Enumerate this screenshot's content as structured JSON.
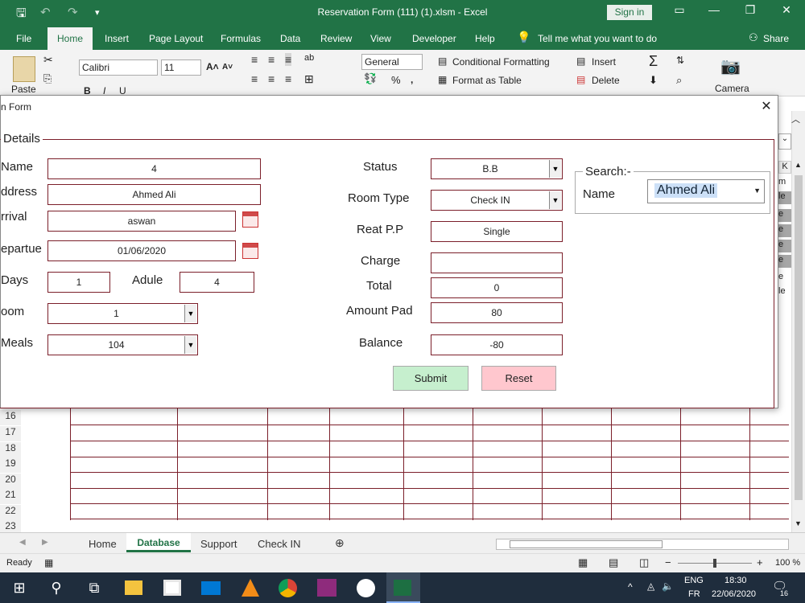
{
  "window": {
    "title": "Reservation Form (111) (1).xlsm  -  Excel",
    "signin": "Sign in"
  },
  "ribbon": {
    "tabs": [
      "File",
      "Home",
      "Insert",
      "Page Layout",
      "Formulas",
      "Data",
      "Review",
      "View",
      "Developer",
      "Help"
    ],
    "tell_me": "Tell me what you want to do",
    "share": "Share",
    "paste": "Paste",
    "font_name": "Calibri",
    "font_size": "11",
    "number_format": "General",
    "conditional_formatting": "Conditional Formatting",
    "format_as_table": "Format as Table",
    "insert": "Insert",
    "delete": "Delete",
    "camera": "Camera",
    "percent": "%"
  },
  "dialog": {
    "title": "n Form",
    "close": "✕",
    "frame_label": "Details",
    "labels": {
      "name": "Name",
      "address": "ddress",
      "arrival": "rrival",
      "departure": "epartue",
      "days": "Days",
      "adule": "Adule",
      "room": "oom",
      "meals": "Meals",
      "status": "Status",
      "room_type": "Room Type",
      "reat_pp": "Reat P.P",
      "charge": "Charge",
      "total": "Total",
      "amount_pad": "Amount Pad",
      "balance": "Balance"
    },
    "values": {
      "name": "4",
      "address": "Ahmed Ali",
      "arrival": "aswan",
      "departure": "01/06/2020",
      "days": "1",
      "adule": "4",
      "room": "1",
      "meals": "104",
      "status": "B.B",
      "room_type": "Check IN",
      "reat_pp": "Single",
      "charge": "",
      "total": "0",
      "amount_pad": "80",
      "balance": "-80"
    },
    "submit": "Submit",
    "reset": "Reset",
    "search": {
      "legend": "Search:-",
      "label": "Name",
      "value": "Ahmed Ali"
    }
  },
  "sheet": {
    "row_numbers": [
      "16",
      "17",
      "18",
      "19",
      "20",
      "21",
      "22",
      "23"
    ],
    "partial_col_letter": "K",
    "partial_cells": [
      "m",
      "le",
      "e",
      "e",
      "e",
      "e",
      "e",
      "le"
    ],
    "tabs": [
      "Home",
      "Database",
      "Support",
      "Check IN"
    ],
    "active_tab": "Database"
  },
  "status": {
    "ready": "Ready",
    "zoom": "100 %"
  },
  "taskbar": {
    "lang_top": "ENG",
    "lang_bottom": "FR",
    "time": "18:30",
    "date": "22/06/2020",
    "notifications": "16"
  }
}
